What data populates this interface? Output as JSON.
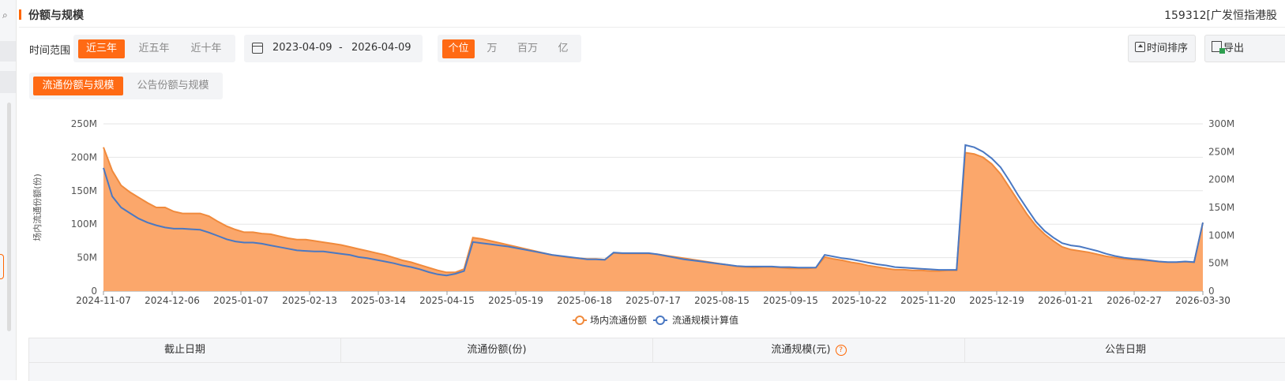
{
  "panel": {
    "title": "份额与规模",
    "fund_code": "159312[广发恒指港股"
  },
  "controls": {
    "range_label": "时间范围",
    "ranges": [
      "近三年",
      "近五年",
      "近十年"
    ],
    "active_range": "近三年",
    "date_start": "2023-04-09",
    "date_sep": "-",
    "date_end": "2026-04-09",
    "units": [
      "个位",
      "万",
      "百万",
      "亿"
    ],
    "active_unit": "个位",
    "sort_label": "时间排序",
    "export_label": "导出"
  },
  "tabs": [
    "流通份额与规模",
    "公告份额与规模"
  ],
  "active_tab": "流通份额与规模",
  "colors": {
    "accent": "#ff6a14",
    "area_fill": "#fba76b",
    "area_line": "#f08a3c",
    "scale_line": "#4a78c2"
  },
  "chart_data": {
    "type": "area",
    "ylabel": "场内流通份额(份)",
    "y_ticks_left": [
      "250M",
      "200M",
      "150M",
      "100M",
      "50M",
      "0"
    ],
    "y_ticks_right": [
      "300M",
      "250M",
      "200M",
      "150M",
      "100M",
      "50M",
      "0"
    ],
    "ylim_left": [
      0,
      250000000
    ],
    "ylim_right": [
      0,
      300000000
    ],
    "x_tick_labels": [
      "2024-11-07",
      "2024-12-06",
      "2025-01-07",
      "2025-02-13",
      "2025-03-14",
      "2025-04-15",
      "2025-05-19",
      "2025-06-18",
      "2025-07-17",
      "2025-08-15",
      "2025-09-15",
      "2025-10-22",
      "2025-11-20",
      "2025-12-19",
      "2026-01-21",
      "2026-02-27",
      "2026-03-30"
    ],
    "grid": true,
    "legend_position": "bottom-center",
    "series": [
      {
        "name": "场内流通份额",
        "axis": "left",
        "values": [
          215,
          180,
          158,
          148,
          140,
          132,
          125,
          125,
          119,
          116,
          116,
          116,
          112,
          104,
          97,
          92,
          88,
          88,
          86,
          85,
          82,
          79,
          77,
          77,
          75,
          73,
          71,
          69,
          66,
          63,
          60,
          57,
          54,
          50,
          46,
          43,
          39,
          35,
          31,
          28,
          28,
          33,
          80,
          78,
          75,
          72,
          69,
          66,
          63,
          60,
          57,
          54,
          52,
          50,
          49,
          48,
          48,
          47,
          57,
          56,
          56,
          56,
          56,
          55,
          53,
          51,
          49,
          47,
          45,
          43,
          41,
          39,
          37,
          36,
          35,
          36,
          36,
          35,
          34,
          34,
          34,
          35,
          51,
          48,
          46,
          43,
          41,
          38,
          36,
          34,
          32,
          32,
          31,
          31,
          30,
          30,
          31,
          31,
          207,
          205,
          200,
          190,
          175,
          155,
          135,
          115,
          98,
          85,
          75,
          66,
          62,
          60,
          58,
          55,
          52,
          50,
          48,
          47,
          46,
          45,
          44,
          43,
          43,
          44,
          43,
          102
        ]
      },
      {
        "name": "流通规模计算值",
        "axis": "right",
        "values": [
          221,
          170,
          150,
          140,
          130,
          123,
          118,
          114,
          112,
          112,
          111,
          110,
          105,
          99,
          93,
          89,
          87,
          87,
          85,
          82,
          79,
          76,
          73,
          72,
          71,
          71,
          69,
          67,
          65,
          61,
          59,
          56,
          53,
          50,
          46,
          43,
          39,
          34,
          30,
          28,
          31,
          36,
          88,
          86,
          84,
          82,
          80,
          77,
          74,
          71,
          68,
          65,
          63,
          61,
          59,
          57,
          57,
          56,
          69,
          68,
          68,
          68,
          68,
          66,
          63,
          60,
          57,
          55,
          53,
          51,
          49,
          47,
          45,
          44,
          44,
          44,
          44,
          43,
          43,
          42,
          42,
          42,
          65,
          62,
          59,
          57,
          54,
          51,
          48,
          46,
          43,
          42,
          41,
          40,
          39,
          38,
          38,
          38,
          262,
          258,
          250,
          238,
          222,
          198,
          172,
          148,
          125,
          108,
          96,
          86,
          82,
          80,
          76,
          72,
          67,
          63,
          60,
          58,
          57,
          55,
          53,
          52,
          52,
          53,
          52,
          123
        ]
      }
    ]
  },
  "table": {
    "headers": [
      "截止日期",
      "流通份额(份)",
      "流通规模(元)",
      "公告日期"
    ],
    "help_glyph": "?"
  }
}
